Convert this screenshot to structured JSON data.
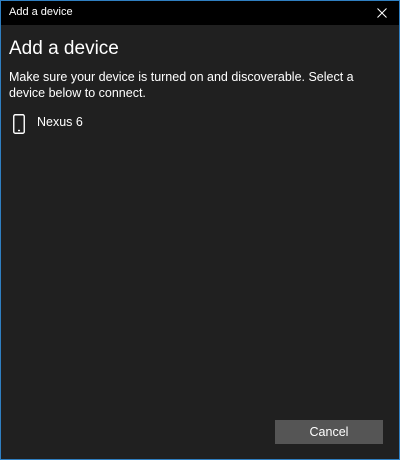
{
  "window": {
    "title": "Add a device",
    "close_icon": "close-icon"
  },
  "main": {
    "heading": "Add a device",
    "instructions": "Make sure your device is turned on and discoverable. Select a device below to connect.",
    "devices": [
      {
        "label": "Nexus 6",
        "icon": "phone-icon"
      }
    ]
  },
  "footer": {
    "cancel_label": "Cancel"
  },
  "colors": {
    "window_border": "#2f7fc1",
    "titlebar_bg": "#000000",
    "content_bg": "#202020",
    "button_bg": "#555555",
    "text": "#ffffff"
  }
}
